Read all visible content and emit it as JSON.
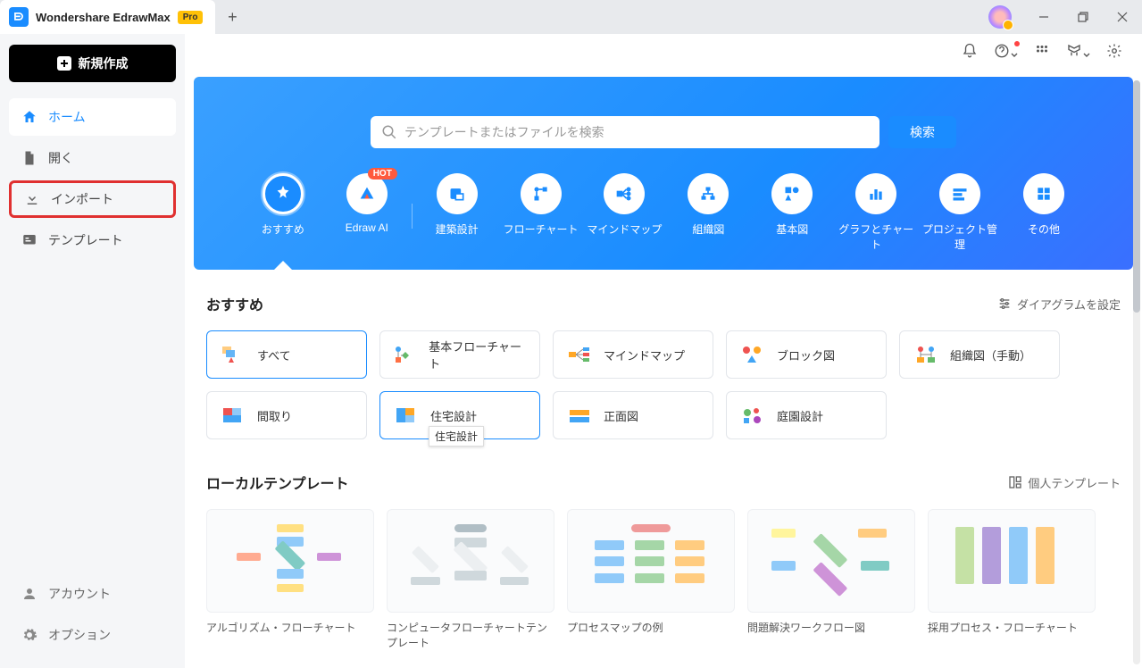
{
  "titlebar": {
    "app_name": "Wondershare EdrawMax",
    "pro_badge": "Pro"
  },
  "sidebar": {
    "new_button": "新規作成",
    "items": [
      {
        "id": "home",
        "label": "ホーム"
      },
      {
        "id": "open",
        "label": "開く"
      },
      {
        "id": "import",
        "label": "インポート"
      },
      {
        "id": "templates",
        "label": "テンプレート"
      }
    ],
    "bottom": [
      {
        "id": "account",
        "label": "アカウント"
      },
      {
        "id": "options",
        "label": "オプション"
      }
    ]
  },
  "hero": {
    "search_placeholder": "テンプレートまたはファイルを検索",
    "search_button": "検索",
    "categories": [
      {
        "id": "recommend",
        "label": "おすすめ"
      },
      {
        "id": "edrawai",
        "label": "Edraw AI",
        "hot": "HOT"
      },
      {
        "id": "arch",
        "label": "建築設計"
      },
      {
        "id": "flow",
        "label": "フローチャート"
      },
      {
        "id": "mindmap",
        "label": "マインドマップ"
      },
      {
        "id": "org",
        "label": "組織図"
      },
      {
        "id": "basic",
        "label": "基本図"
      },
      {
        "id": "chart",
        "label": "グラフとチャート"
      },
      {
        "id": "project",
        "label": "プロジェクト管理"
      },
      {
        "id": "other",
        "label": "その他"
      }
    ]
  },
  "recommend": {
    "title": "おすすめ",
    "config": "ダイアグラムを設定",
    "filters": [
      {
        "id": "all",
        "label": "すべて"
      },
      {
        "id": "basicflow",
        "label": "基本フローチャート"
      },
      {
        "id": "mindmap",
        "label": "マインドマップ"
      },
      {
        "id": "block",
        "label": "ブロック図"
      },
      {
        "id": "orgmanual",
        "label": "組織図（手動）"
      },
      {
        "id": "floorplan",
        "label": "間取り"
      },
      {
        "id": "house",
        "label": "住宅設計",
        "tooltip": "住宅設計"
      },
      {
        "id": "elevation",
        "label": "正面図"
      },
      {
        "id": "garden",
        "label": "庭園設計"
      }
    ]
  },
  "local": {
    "title": "ローカルテンプレート",
    "personal": "個人テンプレート",
    "templates": [
      {
        "label": "アルゴリズム・フローチャート"
      },
      {
        "label": "コンピュータフローチャートテンプレート"
      },
      {
        "label": "プロセスマップの例"
      },
      {
        "label": "問題解決ワークフロー図"
      },
      {
        "label": "採用プロセス・フローチャート"
      }
    ]
  }
}
